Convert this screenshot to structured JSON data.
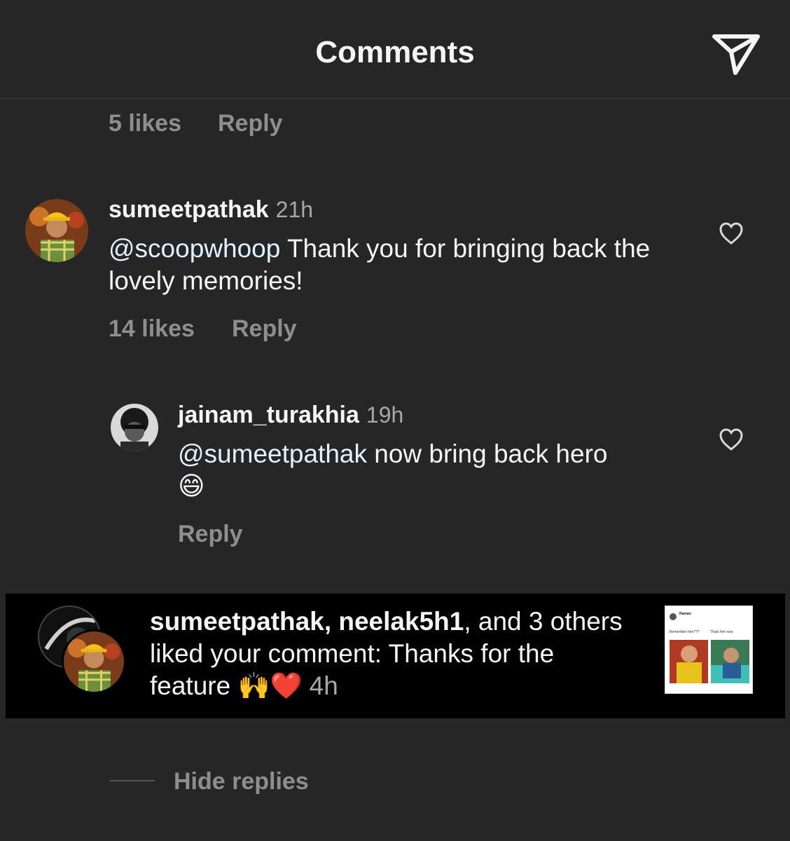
{
  "header": {
    "title": "Comments",
    "send_icon": "paper-plane-icon"
  },
  "top_comment_meta": {
    "likes": "5 likes",
    "reply": "Reply"
  },
  "comments": [
    {
      "username": "sumeetpathak",
      "time": "21h",
      "mention": "@scoopwhoop",
      "text": " Thank you for bringing back the lovely memories!",
      "likes": "14 likes",
      "reply": "Reply",
      "like_icon": "heart-outline-icon"
    },
    {
      "username": "jainam_turakhia",
      "time": "19h",
      "mention": "@sumeetpathak",
      "text": " now bring back hero",
      "emoji": "😄",
      "reply": "Reply",
      "like_icon": "heart-outline-icon"
    }
  ],
  "notification": {
    "user1": "sumeetpathak",
    "sep": ", ",
    "user2": "neelak5h1",
    "rest": ", and 3 others liked your comment: Thanks for the feature ",
    "emojis": "🙌❤️",
    "time": "4h",
    "thumbnail": {
      "author": "Raman",
      "caption_left": "Remember him???",
      "caption_right": "Thats him now"
    }
  },
  "hide_replies": "Hide replies",
  "colors": {
    "background": "#262626",
    "banner": "#000000",
    "muted": "#8e8e8e",
    "mention": "#e0f1ff"
  }
}
